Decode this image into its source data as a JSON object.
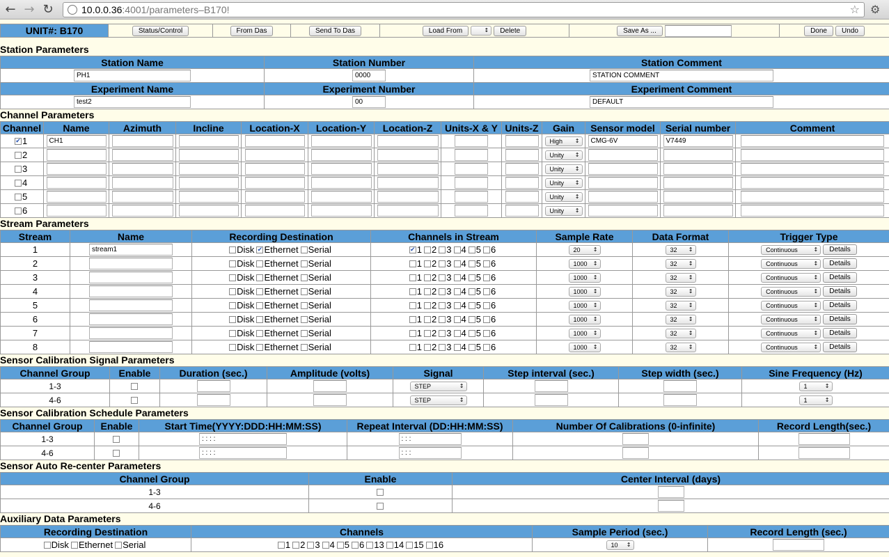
{
  "browser": {
    "url_host": "10.0.0.36",
    "url_rest": ":4001/parameters–B170!"
  },
  "top": {
    "unit": "UNIT#: B170",
    "status": "Status/Control",
    "from_das": "From Das",
    "send_to_das": "Send To Das",
    "load_from": "Load From",
    "delete": "Delete",
    "save_as": "Save As ...",
    "done": "Done",
    "undo": "Undo"
  },
  "station": {
    "title": "Station Parameters",
    "h_name": "Station Name",
    "h_number": "Station Number",
    "h_comment": "Station Comment",
    "name": "PH1",
    "number": "0000",
    "comment": "STATION COMMENT",
    "h_exp_name": "Experiment Name",
    "h_exp_number": "Experiment Number",
    "h_exp_comment": "Experiment Comment",
    "exp_name": "test2",
    "exp_number": "00",
    "exp_comment": "DEFAULT"
  },
  "channel": {
    "title": "Channel Parameters",
    "headers": [
      "Channel",
      "Name",
      "Azimuth",
      "Incline",
      "Location-X",
      "Location-Y",
      "Location-Z",
      "Units-X & Y",
      "Units-Z",
      "Gain",
      "Sensor model",
      "Serial number",
      "Comment"
    ],
    "rows": [
      {
        "num": "1",
        "checked": true,
        "name": "CH1",
        "gain": "High",
        "model": "CMG-6V",
        "serial": "V7449"
      },
      {
        "num": "2",
        "checked": false,
        "name": "",
        "gain": "Unity",
        "model": "",
        "serial": ""
      },
      {
        "num": "3",
        "checked": false,
        "name": "",
        "gain": "Unity",
        "model": "",
        "serial": ""
      },
      {
        "num": "4",
        "checked": false,
        "name": "",
        "gain": "Unity",
        "model": "",
        "serial": ""
      },
      {
        "num": "5",
        "checked": false,
        "name": "",
        "gain": "Unity",
        "model": "",
        "serial": ""
      },
      {
        "num": "6",
        "checked": false,
        "name": "",
        "gain": "Unity",
        "model": "",
        "serial": ""
      }
    ]
  },
  "stream": {
    "title": "Stream Parameters",
    "headers": [
      "Stream",
      "Name",
      "Recording Destination",
      "Channels in Stream",
      "Sample Rate",
      "Data Format",
      "Trigger Type"
    ],
    "dest_labels": [
      "Disk",
      "Ethernet",
      "Serial"
    ],
    "ch_labels": [
      "1",
      "2",
      "3",
      "4",
      "5",
      "6"
    ],
    "details": "Details",
    "rows": [
      {
        "num": "1",
        "name": "stream1",
        "dest": [
          false,
          true,
          false
        ],
        "ch": [
          true,
          false,
          false,
          false,
          false,
          false
        ],
        "rate": "20",
        "format": "32",
        "trigger": "Continuous"
      },
      {
        "num": "2",
        "name": "",
        "dest": [
          false,
          false,
          false
        ],
        "ch": [
          false,
          false,
          false,
          false,
          false,
          false
        ],
        "rate": "1000",
        "format": "32",
        "trigger": "Continuous"
      },
      {
        "num": "3",
        "name": "",
        "dest": [
          false,
          false,
          false
        ],
        "ch": [
          false,
          false,
          false,
          false,
          false,
          false
        ],
        "rate": "1000",
        "format": "32",
        "trigger": "Continuous"
      },
      {
        "num": "4",
        "name": "",
        "dest": [
          false,
          false,
          false
        ],
        "ch": [
          false,
          false,
          false,
          false,
          false,
          false
        ],
        "rate": "1000",
        "format": "32",
        "trigger": "Continuous"
      },
      {
        "num": "5",
        "name": "",
        "dest": [
          false,
          false,
          false
        ],
        "ch": [
          false,
          false,
          false,
          false,
          false,
          false
        ],
        "rate": "1000",
        "format": "32",
        "trigger": "Continuous"
      },
      {
        "num": "6",
        "name": "",
        "dest": [
          false,
          false,
          false
        ],
        "ch": [
          false,
          false,
          false,
          false,
          false,
          false
        ],
        "rate": "1000",
        "format": "32",
        "trigger": "Continuous"
      },
      {
        "num": "7",
        "name": "",
        "dest": [
          false,
          false,
          false
        ],
        "ch": [
          false,
          false,
          false,
          false,
          false,
          false
        ],
        "rate": "1000",
        "format": "32",
        "trigger": "Continuous"
      },
      {
        "num": "8",
        "name": "",
        "dest": [
          false,
          false,
          false
        ],
        "ch": [
          false,
          false,
          false,
          false,
          false,
          false
        ],
        "rate": "1000",
        "format": "32",
        "trigger": "Continuous"
      }
    ]
  },
  "cal_signal": {
    "title": "Sensor Calibration Signal Parameters",
    "headers": [
      "Channel Group",
      "Enable",
      "Duration (sec.)",
      "Amplitude (volts)",
      "Signal",
      "Step interval (sec.)",
      "Step width (sec.)",
      "Sine Frequency (Hz)"
    ],
    "rows": [
      {
        "group": "1-3",
        "signal": "STEP",
        "freq": "1"
      },
      {
        "group": "4-6",
        "signal": "STEP",
        "freq": "1"
      }
    ]
  },
  "cal_schedule": {
    "title": "Sensor Calibration Schedule Parameters",
    "headers": [
      "Channel Group",
      "Enable",
      "Start Time(YYYY:DDD:HH:MM:SS)",
      "Repeat Interval (DD:HH:MM:SS)",
      "Number Of Calibrations (0-infinite)",
      "Record Length(sec.)"
    ],
    "rows": [
      {
        "group": "1-3",
        "start": "  :  :  :  :",
        "repeat": "  :  :  :"
      },
      {
        "group": "4-6",
        "start": "  :  :  :  :",
        "repeat": "  :  :  :"
      }
    ]
  },
  "recenter": {
    "title": "Sensor Auto Re-center Parameters",
    "headers": [
      "Channel Group",
      "Enable",
      "Center Interval (days)"
    ],
    "rows": [
      {
        "group": "1-3"
      },
      {
        "group": "4-6"
      }
    ]
  },
  "aux": {
    "title": "Auxiliary Data Parameters",
    "headers": [
      "Recording Destination",
      "Channels",
      "Sample Period (sec.)",
      "Record Length (sec.)"
    ],
    "dest_labels": [
      "Disk",
      "Ethernet",
      "Serial"
    ],
    "ch_labels": [
      "1",
      "2",
      "3",
      "4",
      "5",
      "6",
      "13",
      "14",
      "15",
      "16"
    ],
    "period": "10"
  }
}
